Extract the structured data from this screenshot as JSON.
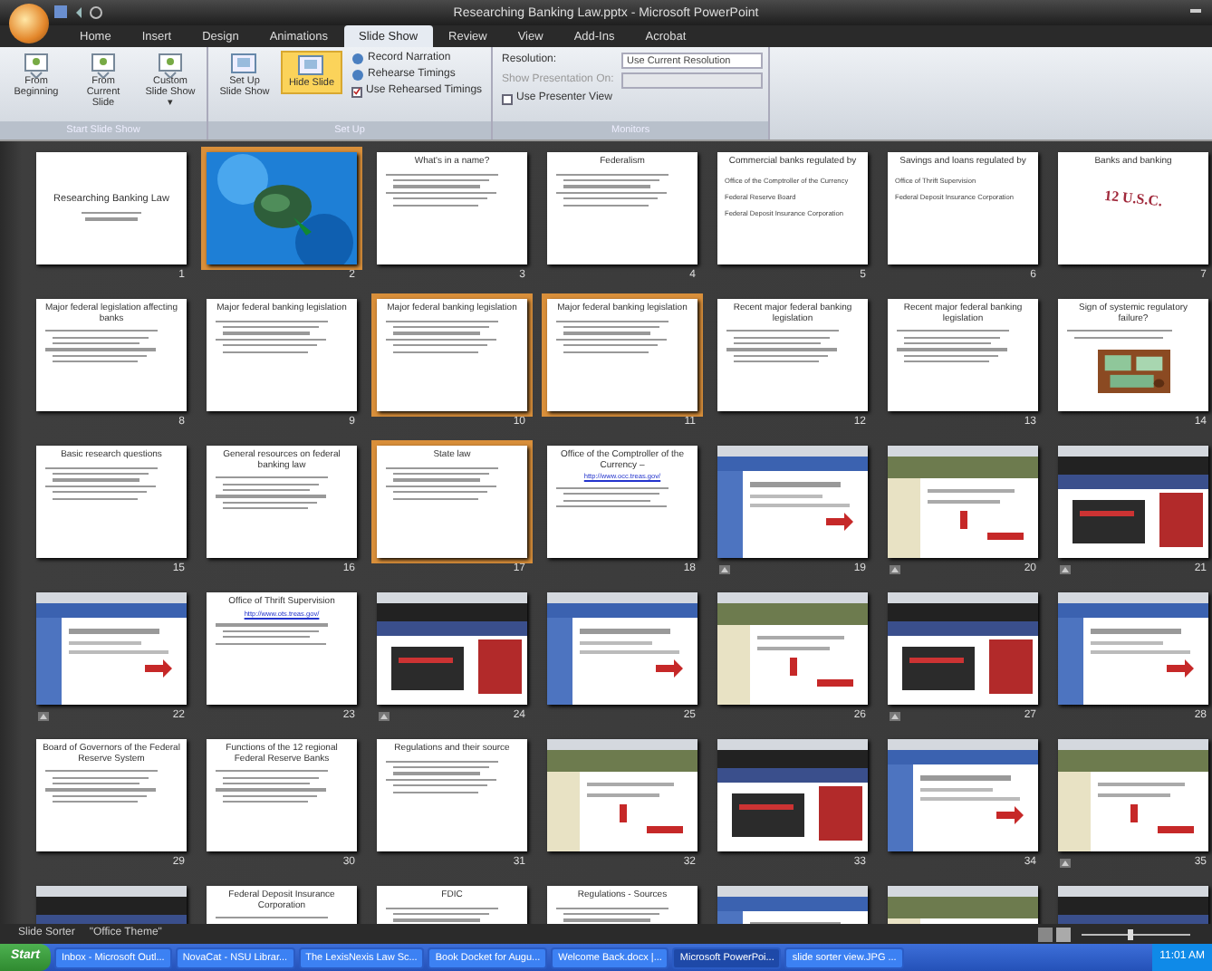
{
  "window": {
    "title": "Researching Banking Law.pptx - Microsoft PowerPoint"
  },
  "tabs": [
    {
      "label": "Home",
      "selected": false
    },
    {
      "label": "Insert",
      "selected": false
    },
    {
      "label": "Design",
      "selected": false
    },
    {
      "label": "Animations",
      "selected": false
    },
    {
      "label": "Slide Show",
      "selected": true
    },
    {
      "label": "Review",
      "selected": false
    },
    {
      "label": "View",
      "selected": false
    },
    {
      "label": "Add-Ins",
      "selected": false
    },
    {
      "label": "Acrobat",
      "selected": false
    }
  ],
  "ribbon": {
    "groups": [
      {
        "label": "Start Slide Show",
        "items": [
          {
            "kind": "big",
            "label": "From Beginning",
            "selected": false
          },
          {
            "kind": "big",
            "label": "From Current Slide",
            "selected": false
          },
          {
            "kind": "big",
            "label": "Custom Slide Show ▾",
            "selected": false
          }
        ]
      },
      {
        "label": "Set Up",
        "items": [
          {
            "kind": "big",
            "label": "Set Up Slide Show",
            "selected": false
          },
          {
            "kind": "big",
            "label": "Hide Slide",
            "selected": true
          },
          {
            "kind": "small",
            "label": "Record Narration"
          },
          {
            "kind": "small",
            "label": "Rehearse Timings"
          },
          {
            "kind": "check",
            "label": "Use Rehearsed Timings",
            "checked": true
          }
        ]
      },
      {
        "label": "Monitors",
        "items": [
          {
            "kind": "combo",
            "label": "Resolution:",
            "value": "Use Current Resolution",
            "disabled": false
          },
          {
            "kind": "combo",
            "label": "Show Presentation On:",
            "value": "",
            "disabled": true
          },
          {
            "kind": "check",
            "label": "Use Presenter View",
            "checked": false
          }
        ]
      }
    ]
  },
  "slides": [
    {
      "number": "1",
      "kind": "title",
      "title": "Researching Banking Law",
      "selected": false,
      "animated": false
    },
    {
      "number": "2",
      "kind": "picture",
      "selected": true,
      "animated": false
    },
    {
      "number": "3",
      "kind": "bullets",
      "title": "What's in a name?",
      "selected": false,
      "animated": false
    },
    {
      "number": "4",
      "kind": "bullets",
      "title": "Federalism",
      "selected": false,
      "animated": false
    },
    {
      "number": "5",
      "kind": "list",
      "title": "Commercial banks regulated by",
      "lines": [
        "Office of the Comptroller of the Currency",
        "Federal Reserve Board",
        "Federal Deposit Insurance Corporation"
      ],
      "selected": false,
      "animated": false
    },
    {
      "number": "6",
      "kind": "list",
      "title": "Savings and loans regulated by",
      "lines": [
        "Office of Thrift Supervision",
        "Federal Deposit Insurance Corporation"
      ],
      "selected": false,
      "animated": false
    },
    {
      "number": "7",
      "kind": "bigtext",
      "title": "Banks and banking",
      "body": "12 U.S.C.",
      "selected": false,
      "animated": false
    },
    {
      "number": "8",
      "kind": "bullets",
      "title": "Major federal legislation affecting banks",
      "selected": false,
      "animated": false
    },
    {
      "number": "9",
      "kind": "bullets",
      "title": "Major federal banking legislation",
      "selected": false,
      "animated": false
    },
    {
      "number": "10",
      "kind": "bullets",
      "title": "Major federal banking legislation",
      "selected": true,
      "animated": false
    },
    {
      "number": "11",
      "kind": "bullets",
      "title": "Major federal banking legislation",
      "selected": true,
      "animated": false
    },
    {
      "number": "12",
      "kind": "bullets",
      "title": "Recent major federal banking legislation",
      "selected": false,
      "animated": false
    },
    {
      "number": "13",
      "kind": "bullets",
      "title": "Recent major federal banking legislation",
      "selected": false,
      "animated": false
    },
    {
      "number": "14",
      "title": "Sign of systemic regulatory failure?",
      "selected": false,
      "animated": false
    },
    {
      "number": "15",
      "kind": "bullets",
      "title": "Basic research questions",
      "selected": false,
      "animated": false
    },
    {
      "number": "16",
      "kind": "bullets",
      "title": "General resources on federal banking law",
      "selected": false,
      "animated": false
    },
    {
      "number": "17",
      "kind": "bullets",
      "title": "State law",
      "selected": true,
      "animated": false
    },
    {
      "number": "18",
      "kind": "bullets",
      "title": "Office of the Comptroller of the Currency –",
      "link": "http://www.occ.treas.gov/",
      "selected": false,
      "animated": false
    },
    {
      "number": "19",
      "kind": "screenshot",
      "selected": false,
      "animated": true
    },
    {
      "number": "20",
      "kind": "screenshot",
      "selected": false,
      "animated": true
    },
    {
      "number": "21",
      "kind": "screenshot",
      "selected": false,
      "animated": true
    },
    {
      "number": "22",
      "kind": "screenshot",
      "selected": false,
      "animated": true
    },
    {
      "number": "23",
      "kind": "bullets",
      "title": "Office of Thrift Supervision",
      "link": "http://www.ots.treas.gov/",
      "selected": false,
      "animated": false
    },
    {
      "number": "24",
      "kind": "screenshot",
      "selected": false,
      "animated": true
    },
    {
      "number": "25",
      "kind": "screenshot",
      "selected": false,
      "animated": false
    },
    {
      "number": "26",
      "kind": "screenshot",
      "selected": false,
      "animated": false
    },
    {
      "number": "27",
      "kind": "screenshot",
      "selected": false,
      "animated": true
    },
    {
      "number": "28",
      "kind": "screenshot",
      "selected": false,
      "animated": false
    },
    {
      "number": "29",
      "kind": "bullets",
      "title": "Board of Governors of the Federal Reserve System",
      "selected": false,
      "animated": false
    },
    {
      "number": "30",
      "kind": "bullets",
      "title": "Functions of the 12 regional Federal Reserve Banks",
      "selected": false,
      "animated": false
    },
    {
      "number": "31",
      "kind": "bullets",
      "title": "Regulations and their source",
      "selected": false,
      "animated": false
    },
    {
      "number": "32",
      "kind": "screenshot",
      "selected": false,
      "animated": false
    },
    {
      "number": "33",
      "kind": "screenshot",
      "selected": false,
      "animated": false
    },
    {
      "number": "34",
      "kind": "screenshot",
      "selected": false,
      "animated": false
    },
    {
      "number": "35",
      "kind": "screenshot",
      "selected": false,
      "animated": true
    },
    {
      "kind": "screenshot",
      "selected": false
    },
    {
      "kind": "bullets",
      "title": "Federal Deposit Insurance Corporation",
      "selected": false
    },
    {
      "kind": "bullets",
      "title": "FDIC",
      "selected": false
    },
    {
      "kind": "bullets",
      "title": "Regulations - Sources",
      "selected": false
    },
    {
      "kind": "screenshot",
      "selected": false
    },
    {
      "kind": "screenshot",
      "selected": false
    },
    {
      "kind": "screenshot",
      "selected": false
    }
  ],
  "status_bar": {
    "view": "Slide Sorter",
    "theme": "\"Office Theme\"",
    "zoom": {
      "level": 0.45
    }
  },
  "taskbar": {
    "start": "Start",
    "items": [
      {
        "label": "Inbox - Microsoft Outl...",
        "selected": false
      },
      {
        "label": "NovaCat - NSU Librar...",
        "selected": false
      },
      {
        "label": "The LexisNexis Law Sc...",
        "selected": false
      },
      {
        "label": "Book Docket for Augu...",
        "selected": false
      },
      {
        "label": "Welcome Back.docx |...",
        "selected": false
      },
      {
        "label": "Microsoft PowerPoi...",
        "selected": true
      },
      {
        "label": "slide sorter view.JPG ...",
        "selected": false
      }
    ],
    "clock": "11:01 AM"
  }
}
